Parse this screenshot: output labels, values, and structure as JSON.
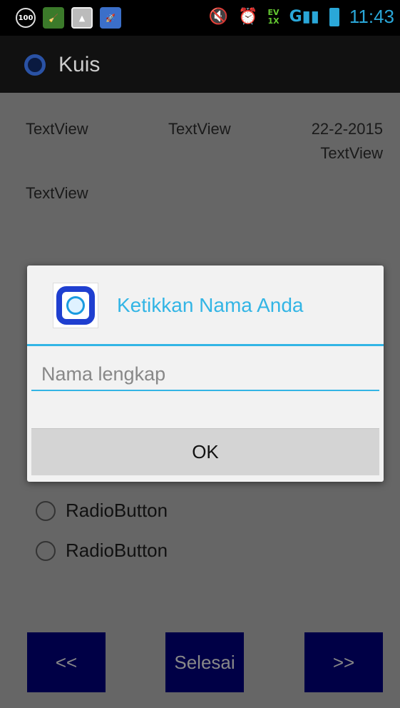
{
  "status_bar": {
    "badge_100": "100",
    "time": "11:43",
    "net_top": "EV",
    "net_bottom": "1X",
    "signal_label": "G"
  },
  "action_bar": {
    "title": "Kuis"
  },
  "content": {
    "tv1": "TextView",
    "tv2": "TextView",
    "date": "22-2-2015",
    "tv3": "TextView",
    "tv4": "TextView",
    "radio1": "RadioButton",
    "radio2": "RadioButton",
    "prev_label": "<<",
    "finish_label": "Selesai",
    "next_label": ">>"
  },
  "dialog": {
    "title": "Ketikkan Nama Anda",
    "input_placeholder": "Nama lengkap",
    "input_value": "",
    "ok_label": "OK"
  },
  "colors": {
    "accent": "#33b5e5",
    "nav_button": "#000046",
    "dim_background": "#666666"
  }
}
